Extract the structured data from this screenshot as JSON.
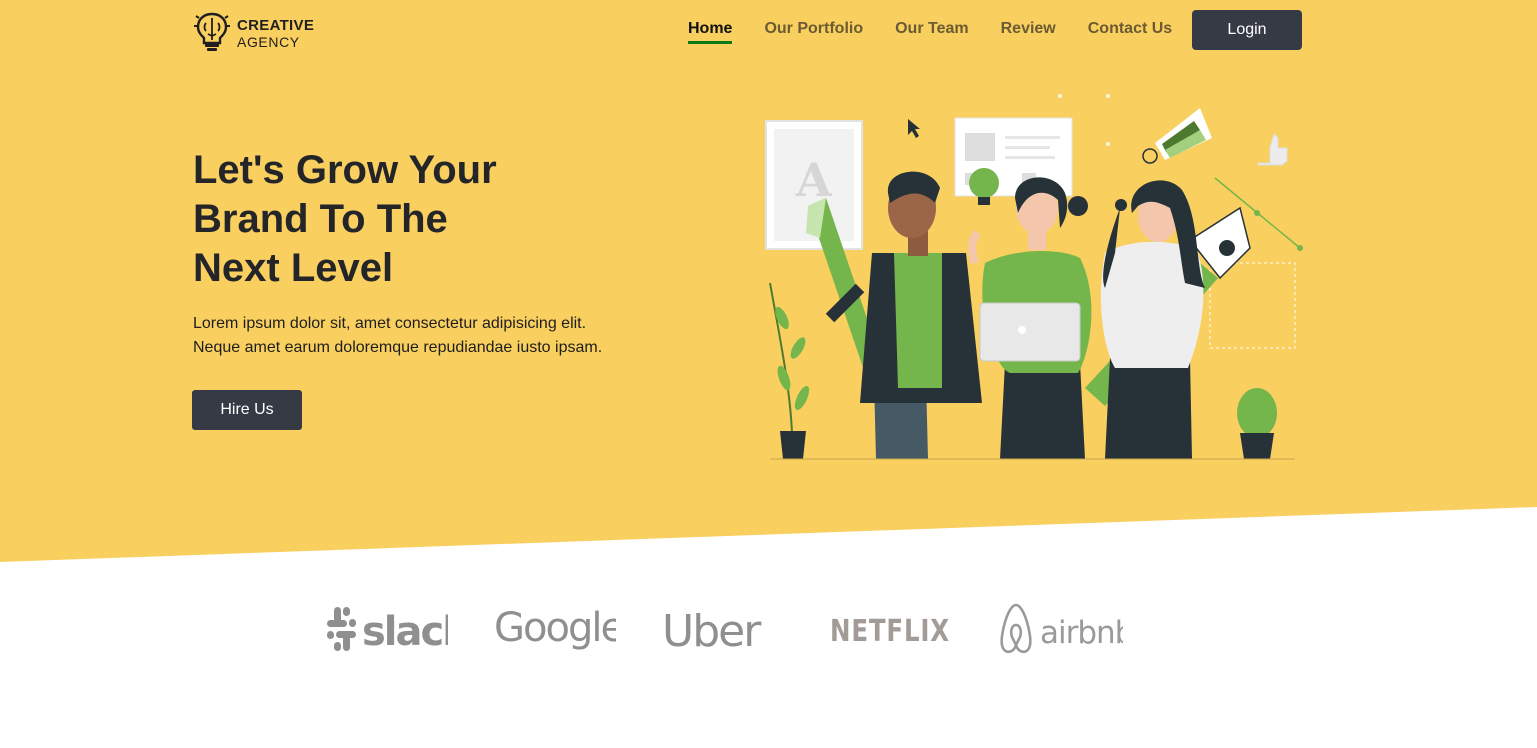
{
  "logo": {
    "line1": "CREATIVE",
    "line2": "AGENCY",
    "icon": "lightbulb-brain-icon"
  },
  "nav": {
    "items": [
      {
        "label": "Home",
        "active": true
      },
      {
        "label": "Our Portfolio",
        "active": false
      },
      {
        "label": "Our Team",
        "active": false
      },
      {
        "label": "Review",
        "active": false
      },
      {
        "label": "Contact Us",
        "active": false
      }
    ],
    "login_label": "Login"
  },
  "hero": {
    "title_lines": [
      "Let's Grow Your",
      "Brand To The",
      "Next Level"
    ],
    "description_lines": [
      "Lorem ipsum dolor sit, amet consectetur adipisicing elit.",
      "Neque amet earum doloremque repudiandae iusto ipsam."
    ],
    "cta_label": "Hire Us"
  },
  "brands": [
    {
      "name": "slack",
      "icon": "slack-logo"
    },
    {
      "name": "Google",
      "icon": "google-logo"
    },
    {
      "name": "Uber",
      "icon": "uber-logo"
    },
    {
      "name": "NETFLIX",
      "icon": "netflix-logo"
    },
    {
      "name": "airbnb",
      "icon": "airbnb-logo"
    }
  ],
  "colors": {
    "hero_bg": "#f9cf5f",
    "dark_button": "#353a45",
    "active_underline": "#0c7a16",
    "illustration_green": "#74b64b",
    "text_dark": "#232529"
  }
}
